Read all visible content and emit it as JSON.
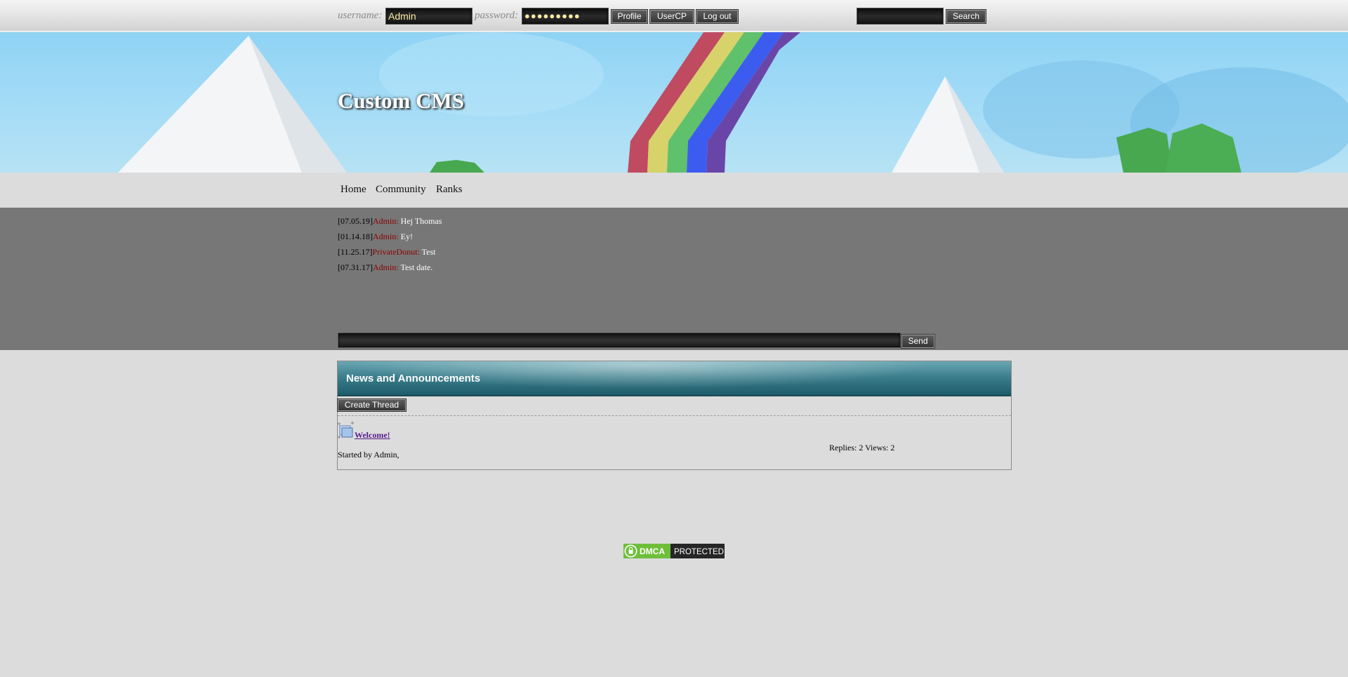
{
  "topbar": {
    "username_label": "username:",
    "username_value": "Admin",
    "password_label": "password:",
    "password_value": "●●●●●●●●●",
    "buttons": [
      {
        "label": "Profile"
      },
      {
        "label": "UserCP"
      },
      {
        "label": "Log out"
      }
    ],
    "search_value": "",
    "search_button": "Search"
  },
  "banner": {
    "title": "Custom CMS"
  },
  "nav": {
    "items": [
      {
        "label": "Home"
      },
      {
        "label": "Community"
      },
      {
        "label": "Ranks"
      }
    ]
  },
  "shoutbox": {
    "messages": [
      {
        "date": "[07.05.19]",
        "user": "Admin:",
        "text": "Hej Thomas"
      },
      {
        "date": "[01.14.18]",
        "user": "Admin:",
        "text": "Ey!"
      },
      {
        "date": "[11.25.17]",
        "user": "PrivateDonut:",
        "text": "Test"
      },
      {
        "date": "[07.31.17]",
        "user": "Admin:",
        "text": "Test date."
      }
    ],
    "input_value": "",
    "send_button": "Send"
  },
  "forum": {
    "title": "News and Announcements",
    "create_thread_button": "Create Thread",
    "threads": [
      {
        "title": "Welcome!",
        "meta": "Started by Admin,",
        "stats": "Replies: 2 Views: 2"
      }
    ]
  },
  "footer": {
    "badge_left": "DMCA",
    "badge_right": "PROTECTED"
  },
  "colors": {
    "shout_date": "#000000",
    "shout_user": "#8b0000",
    "shout_text": "#ffffff",
    "forum_header": "#2a6a77",
    "thread_link": "#551a8b"
  }
}
